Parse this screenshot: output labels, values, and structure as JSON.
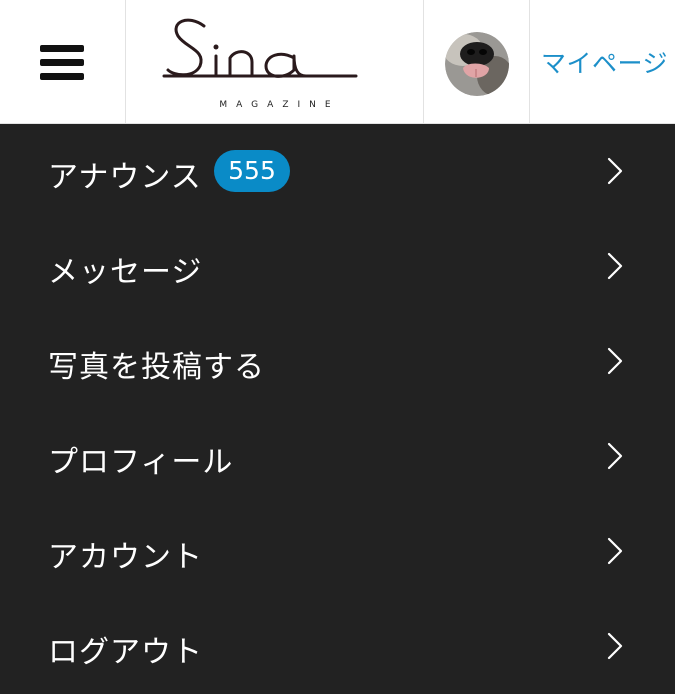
{
  "header": {
    "menu_icon": "hamburger-menu-icon",
    "logo_text": "Sina",
    "logo_subtitle": "MAGAZINE",
    "mypage_label": "マイページ",
    "accent_color": "#1c8fc9"
  },
  "menu": {
    "background": "#222222",
    "badge_color": "#0a8bc7",
    "items": [
      {
        "label": "アナウンス",
        "badge": "555"
      },
      {
        "label": "メッセージ"
      },
      {
        "label": "写真を投稿する"
      },
      {
        "label": "プロフィール"
      },
      {
        "label": "アカウント"
      },
      {
        "label": "ログアウト"
      }
    ]
  }
}
